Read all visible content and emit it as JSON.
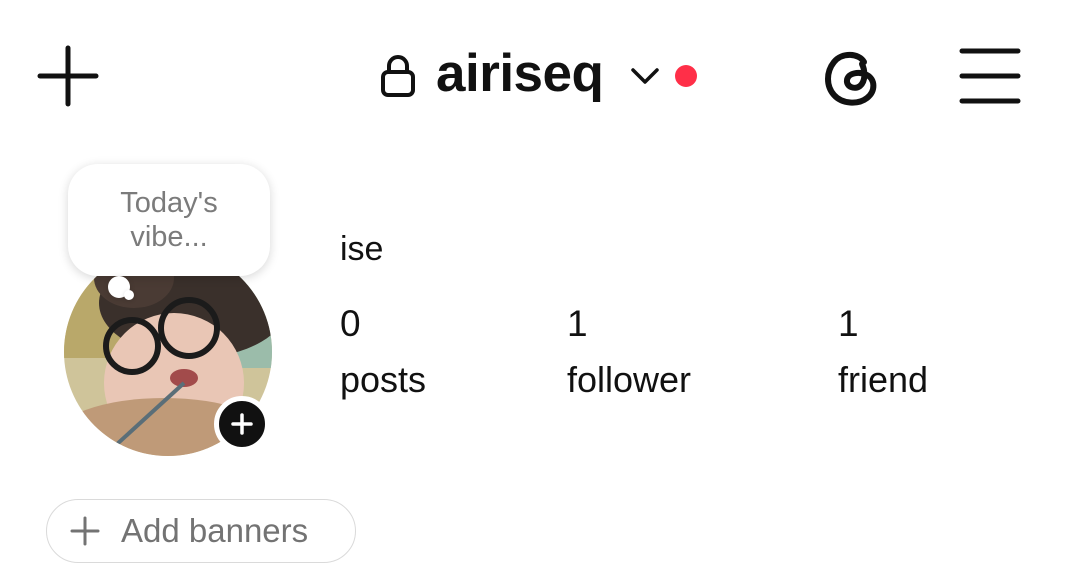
{
  "header": {
    "username": "airiseq",
    "icons": {
      "new_post": "plus-icon",
      "privacy": "lock-icon",
      "switch_account": "chevron-down-icon",
      "threads": "threads-icon",
      "menu": "hamburger-menu-icon"
    },
    "notification_dot_color": "#ff2f48"
  },
  "note": {
    "text": "Today's vibe..."
  },
  "profile": {
    "display_name": "ise",
    "avatar_icon": "profile-photo",
    "stats": [
      {
        "count": "0",
        "label": "posts"
      },
      {
        "count": "1",
        "label": "follower"
      },
      {
        "count": "1",
        "label": "friend"
      }
    ]
  },
  "banners": {
    "label": "Add banners",
    "icon": "plus-icon"
  }
}
